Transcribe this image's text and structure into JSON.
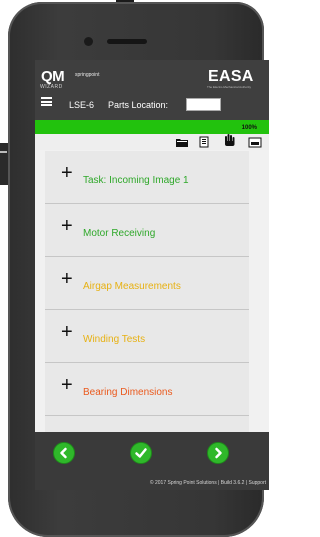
{
  "header": {
    "logo_text": "QM",
    "logo_subtext": "WIZARD",
    "brand_text": "springpoint",
    "partner_logo": "EASA",
    "partner_subtext": "The Electro-Mechanical Authority",
    "lse_label": "LSE-6",
    "parts_location_label": "Parts Location:",
    "parts_location_value": ""
  },
  "toolbar": {
    "progress_percent": 100,
    "progress_text": "100%",
    "icons": [
      "folder-icon",
      "document-icon",
      "hand-icon",
      "layers-icon"
    ]
  },
  "tasks": [
    {
      "label": "Task: Incoming Image 1",
      "color": "#2fa82a"
    },
    {
      "label": "Motor Receiving",
      "color": "#2fa82a"
    },
    {
      "label": "Airgap Measurements",
      "color": "#e7b112"
    },
    {
      "label": "Winding Tests",
      "color": "#e7b112"
    },
    {
      "label": "Bearing Dimensions",
      "color": "#ea5a1e"
    }
  ],
  "footer": {
    "copyright": "© 2017 Spring Point Solutions | Build 3.6.2 | Support"
  },
  "colors": {
    "green": "#22c20d",
    "header_bg": "#3f3f3f",
    "footer_bg": "#3a3a3a"
  }
}
